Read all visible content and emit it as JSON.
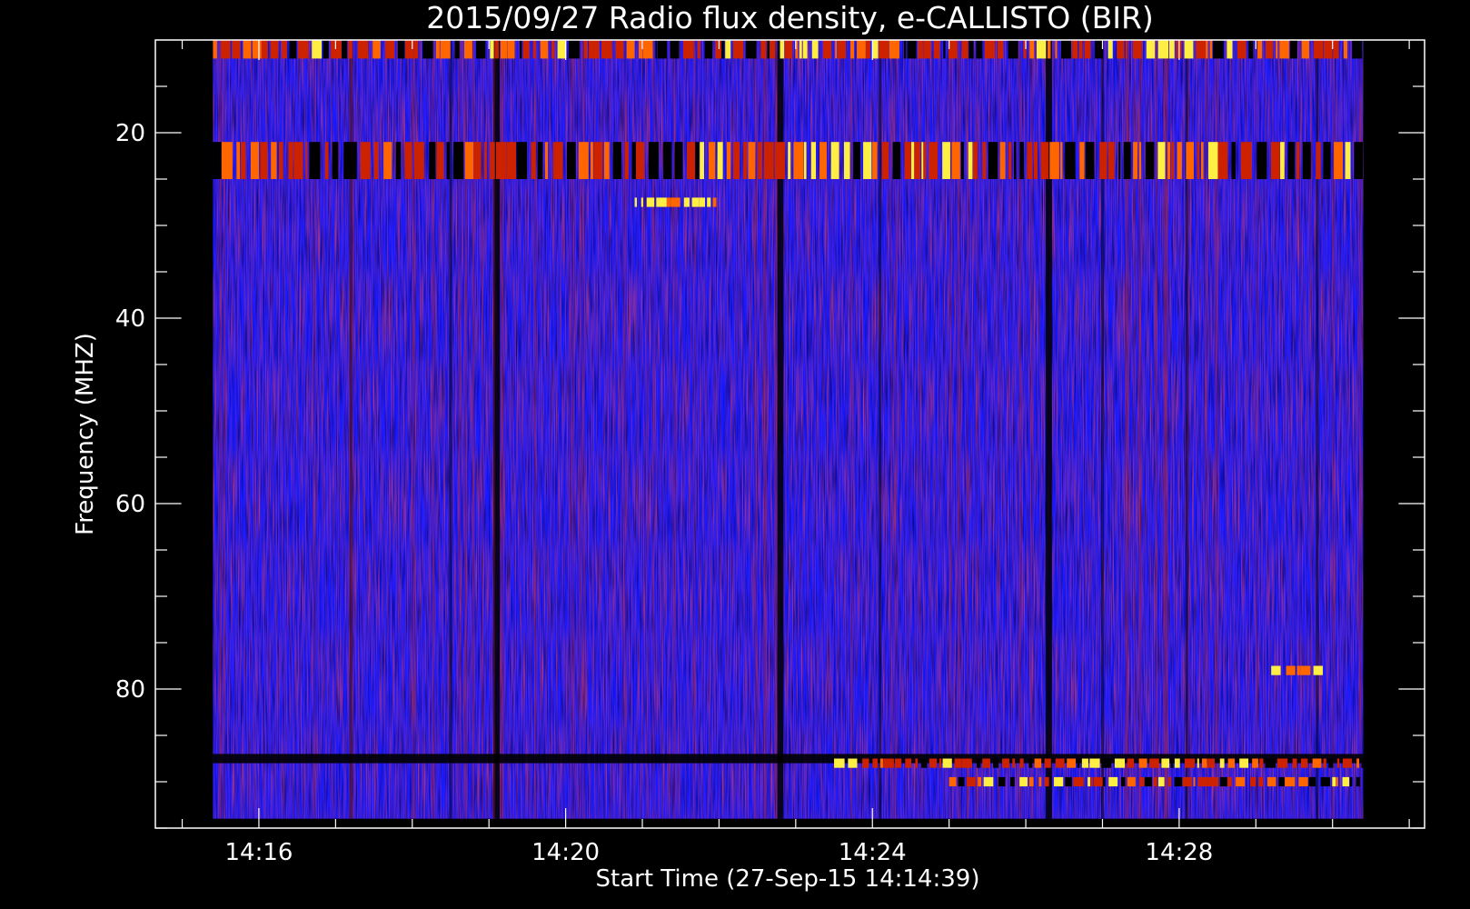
{
  "chart_data": {
    "type": "heatmap",
    "title": "2015/09/27  Radio flux density, e-CALLISTO (BIR)",
    "xlabel": "Start Time (27-Sep-15 14:14:39)",
    "ylabel": "Frequency (MHZ)",
    "x_tick_labels": [
      "14:16",
      "14:20",
      "14:24",
      "14:28"
    ],
    "y_tick_labels": [
      "20",
      "40",
      "60",
      "80"
    ],
    "y_ticks": [
      20,
      40,
      60,
      80
    ],
    "x_ticks_minutes": [
      16,
      20,
      24,
      28
    ],
    "ylim": [
      10,
      95
    ],
    "xlim_minutes": [
      14.65,
      31.2
    ],
    "data_time_range_minutes": [
      15.4,
      30.4
    ],
    "data_freq_range_mhz": [
      10,
      94
    ],
    "y_axis_inverted": true,
    "colormap": "black-blue-red-yellow",
    "colors": {
      "background": "#000000",
      "axis": "#ffffff",
      "low": "#000000",
      "mid": "#1a1aff",
      "high": "#cc2200",
      "peak": "#ffee44"
    },
    "features": [
      {
        "desc": "strong band",
        "freq": [
          10,
          12
        ],
        "intensity": "high"
      },
      {
        "desc": "strong band",
        "freq": [
          21,
          25
        ],
        "intensity": "high"
      },
      {
        "desc": "dark band",
        "freq": [
          87,
          88
        ],
        "intensity": "low"
      },
      {
        "desc": "bright band",
        "freq": [
          87.5,
          88.5
        ],
        "time": [
          23.5,
          30.4
        ],
        "intensity": "high"
      },
      {
        "desc": "bright band",
        "freq": [
          89.5,
          90.5
        ],
        "time": [
          25,
          30.4
        ],
        "intensity": "high"
      },
      {
        "desc": "burst",
        "freq": [
          27,
          28
        ],
        "time": [
          20.9,
          22
        ],
        "intensity": "peak"
      },
      {
        "desc": "burst",
        "freq": [
          77.5,
          78.5
        ],
        "time": [
          29.2,
          29.9
        ],
        "intensity": "peak"
      }
    ]
  }
}
